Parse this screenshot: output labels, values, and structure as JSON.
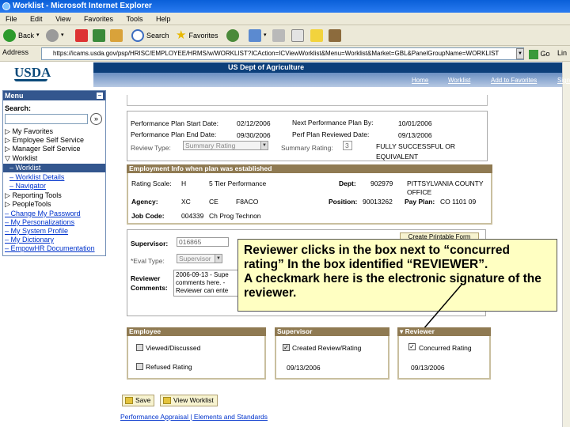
{
  "window": {
    "title": "Worklist - Microsoft Internet Explorer"
  },
  "menubar": [
    "File",
    "Edit",
    "View",
    "Favorites",
    "Tools",
    "Help"
  ],
  "toolbar": {
    "back": "Back",
    "search": "Search",
    "favorites": "Favorites"
  },
  "address": {
    "label": "Address",
    "url": "https://icams.usda.gov/psp/HRISC/EMPLOYEE/HRMS/w/WORKLIST?ICAction=ICViewWorklist&Menu=Worklist&Market=GBL&PanelGroupName=WORKLIST",
    "go": "Go",
    "links": "Lin"
  },
  "header": {
    "logo": "USDA",
    "agency": "US Dept of Agriculture",
    "nav": [
      "Home",
      "Worklist",
      "Add to Favorites",
      "Sign"
    ]
  },
  "menu": {
    "title": "Menu",
    "search_label": "Search:",
    "items": [
      {
        "label": "My Favorites",
        "prefix": "▷"
      },
      {
        "label": "Employee Self Service",
        "prefix": "▷"
      },
      {
        "label": "Manager Self Service",
        "prefix": "▷"
      },
      {
        "label": "Worklist",
        "prefix": "▽"
      },
      {
        "label": "Worklist",
        "prefix": "–"
      },
      {
        "label": "Worklist Details",
        "prefix": "–"
      },
      {
        "label": "Navigator",
        "prefix": "–"
      },
      {
        "label": "Reporting Tools",
        "prefix": "▷"
      },
      {
        "label": "PeopleTools",
        "prefix": "▷"
      },
      {
        "label": "Change My Password",
        "prefix": "–"
      },
      {
        "label": "My Personalizations",
        "prefix": "–"
      },
      {
        "label": "My System Profile",
        "prefix": "–"
      },
      {
        "label": "My Dictionary",
        "prefix": "–"
      },
      {
        "label": "EmpowHR Documentation",
        "prefix": "–"
      }
    ]
  },
  "plan": {
    "start_label": "Performance Plan Start Date:",
    "start_value": "02/12/2006",
    "end_label": "Performance Plan End Date:",
    "end_value": "09/30/2006",
    "next_label": "Next Performance Plan By:",
    "next_value": "10/01/2006",
    "reviewed_label": "Perf Plan Reviewed Date:",
    "reviewed_value": "09/13/2006",
    "review_type_label": "Review Type:",
    "review_type_value": "Summary Rating",
    "summary_label": "Summary Rating:",
    "summary_code": "3",
    "summary_text_1": "FULLY SUCCESSFUL OR",
    "summary_text_2": "EQUIVALENT"
  },
  "employment": {
    "heading": "Employment Info when plan was established",
    "rating_scale_label": "Rating Scale:",
    "rating_scale_code": "H",
    "rating_scale_text": "5 Tier Performance",
    "dept_label": "Dept:",
    "dept_code": "902979",
    "dept_name_1": "PITTSYLVANIA COUNTY",
    "dept_name_2": "OFFICE",
    "agency_label": "Agency:",
    "agency_codes": [
      "XC",
      "CE",
      "F8ACO"
    ],
    "position_label": "Position:",
    "position_value": "90013262",
    "pay_plan_label": "Pay Plan:",
    "pay_plan_value": "CO  1101  09",
    "job_code_label": "Job Code:",
    "job_code_value": "004339",
    "job_code_text": "Ch Prog Technon"
  },
  "review": {
    "supervisor_label": "Supervisor:",
    "supervisor_value": "016865",
    "eval_type_label": "*Eval Type:",
    "eval_type_value": "Supervisor",
    "comments_label_1": "Reviewer",
    "comments_label_2": "Comments:",
    "comments_lines": [
      "2006-09-13 - Supe",
      "comments here. -",
      "Reviewer can ente"
    ],
    "printable_button": "Create Printable Form"
  },
  "callout": {
    "line1": "Reviewer clicks in the box next to “concurred rating” In the box identified “REVIEWER”.",
    "line2": "A checkmark here is the electronic signature of the reviewer."
  },
  "signoff": {
    "employee": {
      "heading": "Employee",
      "viewed": "Viewed/Discussed",
      "refused": "Refused Rating"
    },
    "supervisor": {
      "heading": "Supervisor",
      "created": "Created Review/Rating",
      "date": "09/13/2006"
    },
    "reviewer": {
      "heading": "Reviewer",
      "concurred": "Concurred Rating",
      "date": "09/13/2006"
    }
  },
  "buttons": {
    "save": "Save",
    "view_worklist": "View Worklist"
  },
  "footer_link": "Performance Appraisal | Elements and Standards"
}
